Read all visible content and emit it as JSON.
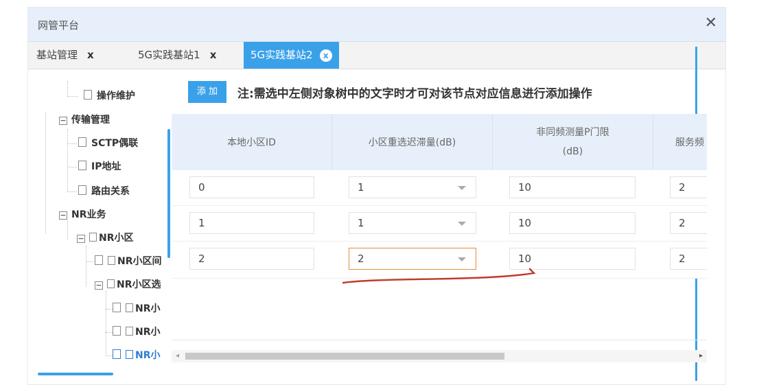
{
  "window": {
    "title": "网管平台",
    "close_icon": "close-icon"
  },
  "tabs": [
    {
      "label": "基站管理",
      "close": "x",
      "active": false
    },
    {
      "label": "5G实践基站1",
      "close": "x",
      "active": false
    },
    {
      "label": "5G实践基站2",
      "close": "x",
      "active": true
    }
  ],
  "tree": {
    "items": [
      {
        "label": "操作维护",
        "type": "doc"
      },
      {
        "label": "传输管理",
        "type": "folder",
        "expander": "−"
      },
      {
        "label": "SCTP偶联",
        "type": "doc"
      },
      {
        "label": "IP地址",
        "type": "doc"
      },
      {
        "label": "路由关系",
        "type": "doc"
      },
      {
        "label": "NR业务",
        "type": "folder",
        "expander": "−"
      },
      {
        "label": "NR小区",
        "type": "folder",
        "expander": "−"
      },
      {
        "label": "NR小区间",
        "type": "doc"
      },
      {
        "label": "NR小区选",
        "type": "folder",
        "expander": "−"
      },
      {
        "label": "NR小",
        "type": "doc"
      },
      {
        "label": "NR小",
        "type": "doc"
      },
      {
        "label": "NR小",
        "type": "doc",
        "selected": true
      }
    ]
  },
  "toolbar": {
    "add_label": "添 加",
    "note": "注:需选中左侧对象树中的文字时才可对该节点对应信息进行添加操作"
  },
  "table": {
    "headers": [
      "本地小区ID",
      "小区重选迟滞量(dB)",
      "非同频测量P门限",
      "(dB)",
      "服务频"
    ],
    "rows": [
      {
        "local_cell_id": "0",
        "hysteresis": "1",
        "threshold": "10",
        "service": "2"
      },
      {
        "local_cell_id": "1",
        "hysteresis": "1",
        "threshold": "10",
        "service": "2"
      },
      {
        "local_cell_id": "2",
        "hysteresis": "2",
        "threshold": "10",
        "service": "2"
      }
    ]
  },
  "colors": {
    "accent": "#3aa1e9",
    "focus": "#e8893a",
    "annotation": "#c0392b"
  }
}
